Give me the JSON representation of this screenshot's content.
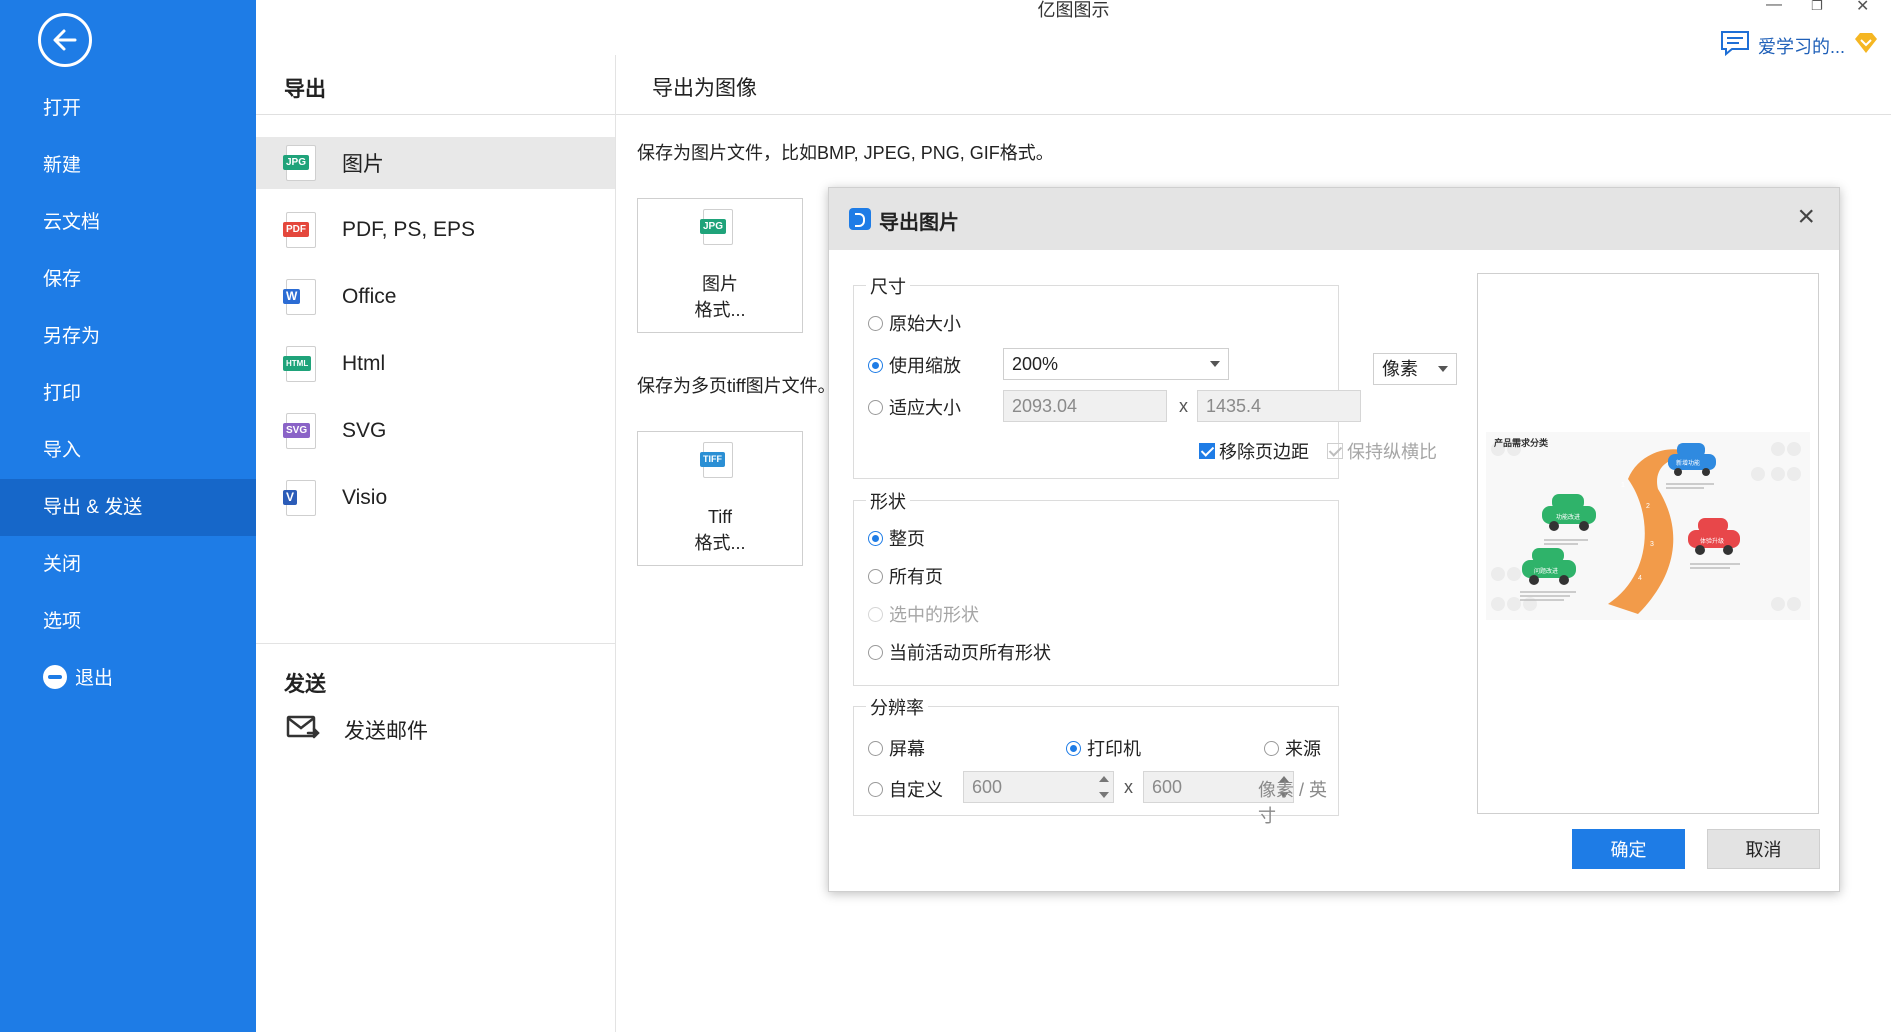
{
  "app": {
    "title": "亿图图示",
    "user_name": "爱学习的..."
  },
  "sidebar": {
    "items": [
      {
        "label": "打开"
      },
      {
        "label": "新建"
      },
      {
        "label": "云文档"
      },
      {
        "label": "保存"
      },
      {
        "label": "另存为"
      },
      {
        "label": "打印"
      },
      {
        "label": "导入"
      },
      {
        "label": "导出 & 发送",
        "active": true
      },
      {
        "label": "关闭"
      },
      {
        "label": "选项"
      },
      {
        "label": "退出"
      }
    ]
  },
  "export_panel": {
    "title": "导出",
    "formats": [
      {
        "label": "图片",
        "tag": "JPG",
        "color": "#1fa37a"
      },
      {
        "label": "PDF, PS, EPS",
        "tag": "PDF",
        "color": "#e4473c"
      },
      {
        "label": "Office",
        "tag": "W",
        "color": "#2b6cd4"
      },
      {
        "label": "Html",
        "tag": "HTML",
        "color": "#1fa37a"
      },
      {
        "label": "SVG",
        "tag": "SVG",
        "color": "#8a63c7"
      },
      {
        "label": "Visio",
        "tag": "V",
        "color": "#2b5cb8"
      }
    ],
    "send_title": "发送",
    "send_email": "发送邮件"
  },
  "content": {
    "title": "导出为图像",
    "desc_image": "保存为图片文件，比如BMP, JPEG, PNG, GIF格式。",
    "image_box_line1": "图片",
    "image_box_line2": "格式...",
    "image_box_tag": "JPG",
    "desc_tiff": "保存为多页tiff图片文件。",
    "tiff_box_line1": "Tiff",
    "tiff_box_line2": "格式...",
    "tiff_box_tag": "TIFF"
  },
  "dialog": {
    "title": "导出图片",
    "size": {
      "title": "尺寸",
      "original": "原始大小",
      "use_zoom": "使用缩放",
      "zoom_value": "200%",
      "fit_size": "适应大小",
      "width": "2093.04",
      "height": "1435.4",
      "x": "x",
      "unit": "像素",
      "remove_margin": "移除页边距",
      "keep_ratio": "保持纵横比"
    },
    "shape": {
      "title": "形状",
      "whole_page": "整页",
      "all_pages": "所有页",
      "selected": "选中的形状",
      "current_all": "当前活动页所有形状"
    },
    "resolution": {
      "title": "分辨率",
      "screen": "屏幕",
      "printer": "打印机",
      "source": "来源",
      "custom": "自定义",
      "value1": "600",
      "value2": "600",
      "x": "x",
      "unit": "像素 / 英寸"
    },
    "preview": {
      "title": "产品需求分类",
      "labels": [
        "功能改进",
        "新增功能",
        "体验升级",
        "问题改进"
      ],
      "steps": [
        "1",
        "2",
        "3",
        "4"
      ]
    },
    "ok": "确定",
    "cancel": "取消"
  }
}
